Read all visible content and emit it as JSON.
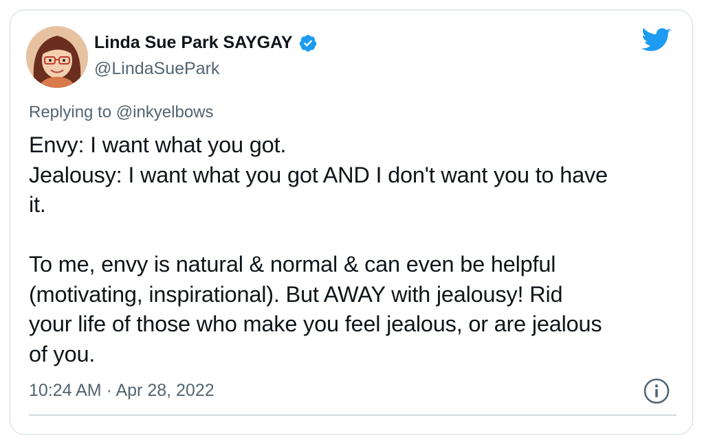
{
  "author": {
    "display_name": "Linda Sue Park SAYGAY",
    "handle": "@LindaSuePark",
    "verified": true,
    "avatar_icon": "illustrated-avatar-woman-glasses"
  },
  "reply": {
    "prefix": "Replying to",
    "mention": "@inkyelbows"
  },
  "tweet_lines": [
    "Envy: I want what you got.",
    "Jealousy: I want what you got AND I don't want you to have",
    "it.",
    "",
    "To me, envy is natural & normal & can even be helpful",
    "(motivating, inspirational). But AWAY with jealousy! Rid",
    "your life of those who make you feel jealous, or are jealous",
    "of you."
  ],
  "timestamp": "10:24 AM · Apr 28, 2022",
  "icons": {
    "brand": "twitter-bird-icon",
    "info": "info-icon",
    "verified": "verified-badge-icon"
  },
  "colors": {
    "twitter_blue": "#1d9bf0",
    "text_primary": "#0f1419",
    "text_secondary": "#536471",
    "border": "#cfd9de"
  }
}
